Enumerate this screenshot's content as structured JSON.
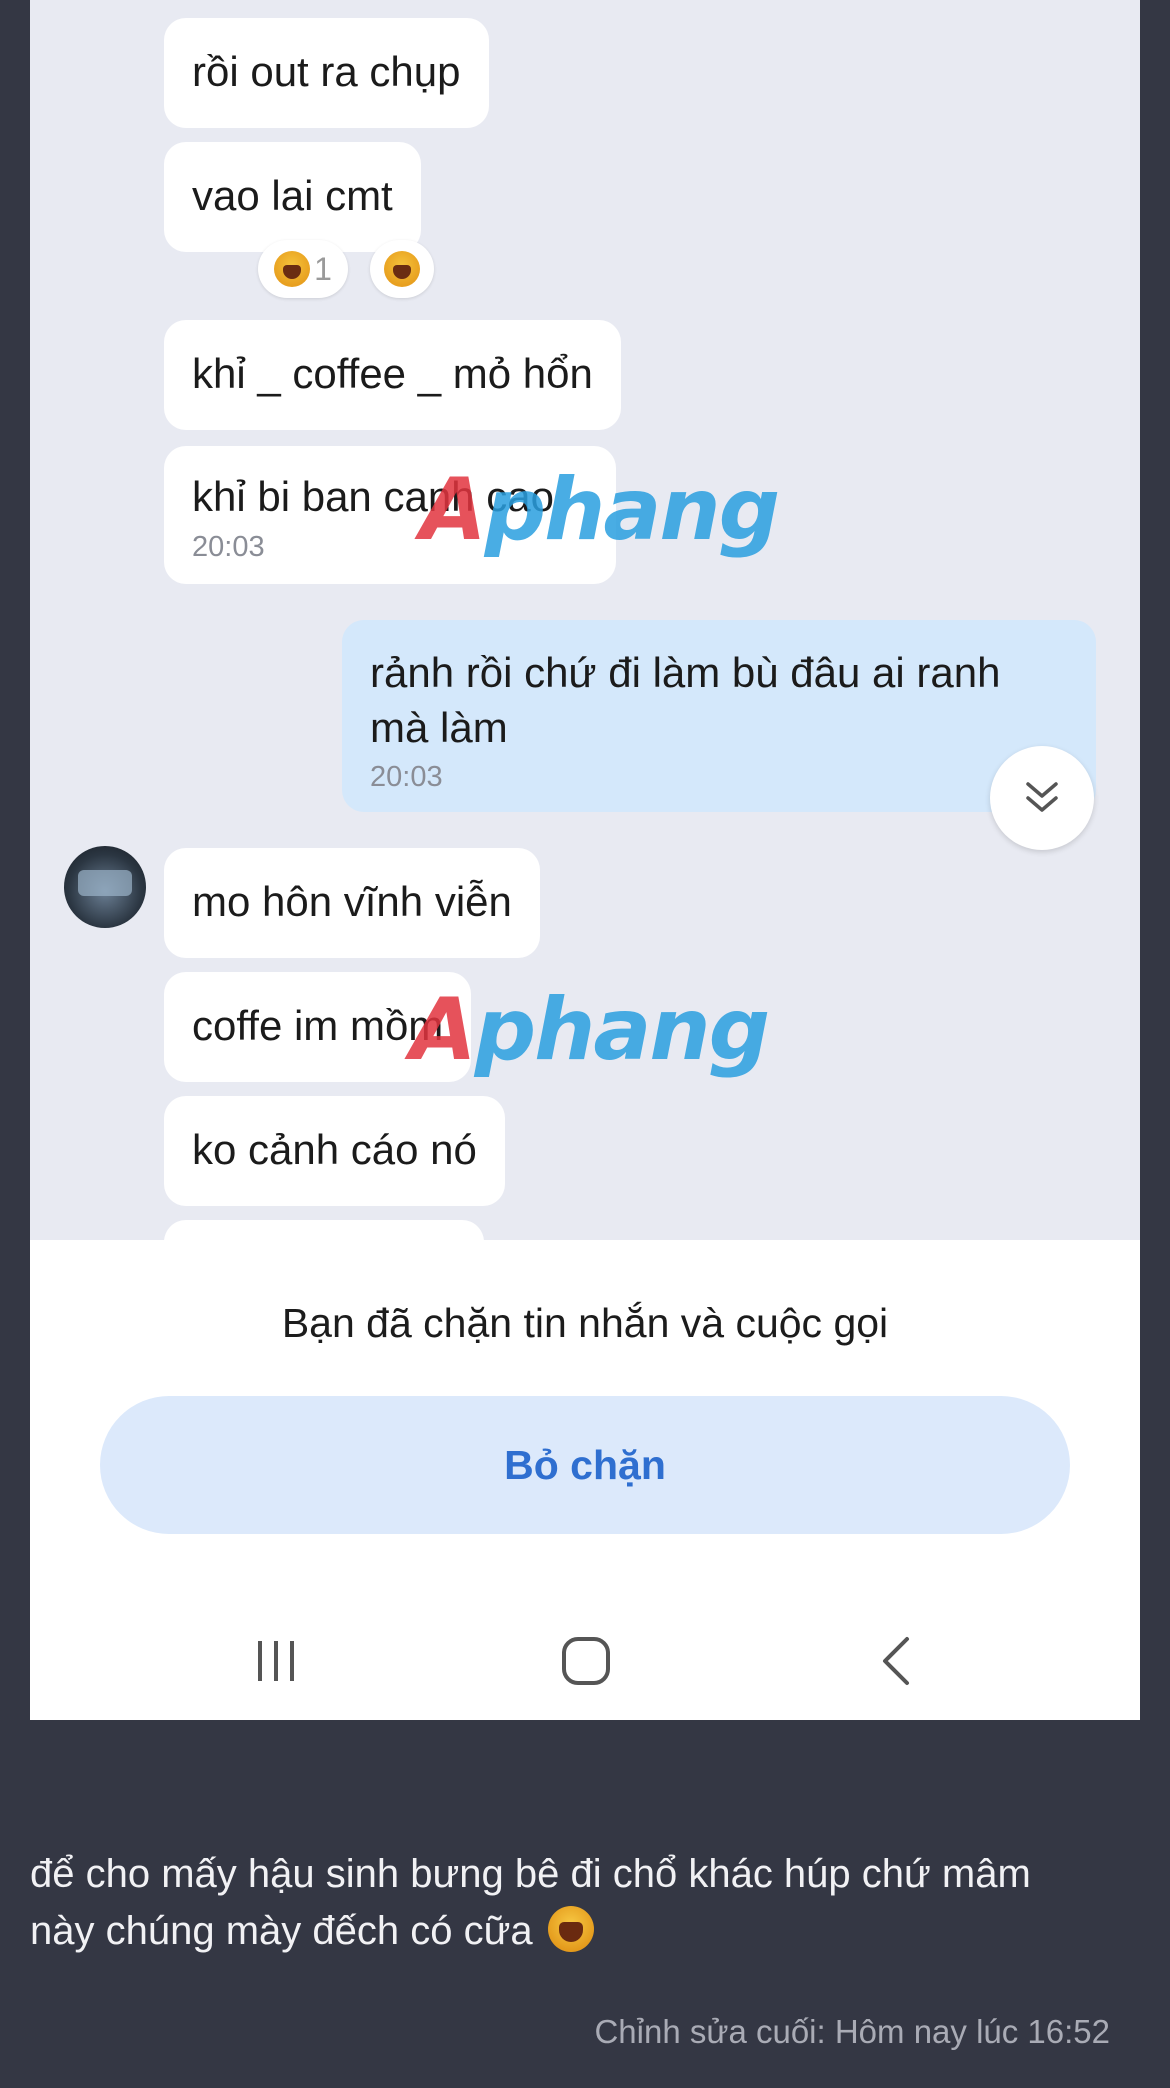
{
  "chat": {
    "messages": [
      {
        "text": "rồi out ra chụp"
      },
      {
        "text": "vao lai cmt",
        "reaction_count": "1"
      },
      {
        "text": "khỉ _ coffee _ mỏ hổn"
      },
      {
        "text": "khỉ bi ban canh cao",
        "time": "20:03"
      },
      {
        "text_line1": "rảnh rồi chứ đi làm bù đâu ai ranh",
        "text_line2": "mà làm",
        "time": "20:03"
      },
      {
        "text": "mo hôn vĩnh viễn"
      },
      {
        "text": "coffe im mồm"
      },
      {
        "text": "ko cảnh cáo nó"
      }
    ],
    "watermark": {
      "part1": "A",
      "part2": "phang"
    }
  },
  "blocked": {
    "notice": "Bạn đã chặn tin nhắn và cuộc gọi",
    "unblock_label": "Bỏ chặn"
  },
  "icons": {
    "scroll_down": "double-chevron-down-icon",
    "nav_recents": "recents-icon",
    "nav_home": "home-icon",
    "nav_back": "back-icon",
    "reaction": "laughing-emoji-icon"
  },
  "post": {
    "line1": "để cho mấy hậu sinh bưng bê đi chổ khác húp chứ mâm",
    "line2": "này chúng mày đếch có cữa",
    "edited": "Chỉnh sửa cuối: Hôm nay lúc 16:52"
  },
  "colors": {
    "page_bg": "#343744",
    "chat_bg": "#e8eaf2",
    "my_bubble": "#d4e8fb",
    "unblock_bg": "#dce9fb",
    "unblock_text": "#2f6fd0"
  }
}
